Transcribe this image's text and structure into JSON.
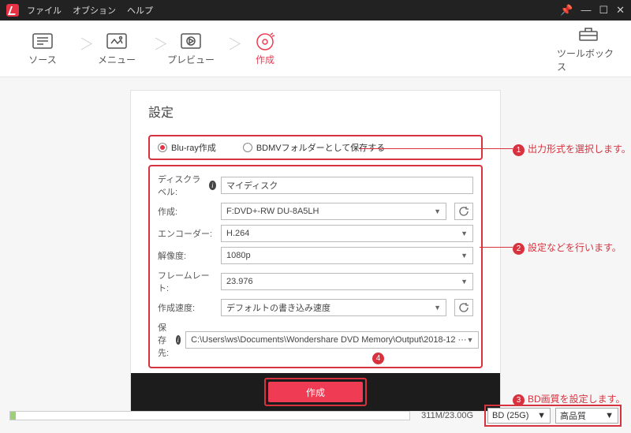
{
  "menu": {
    "file": "ファイル",
    "options": "オブション",
    "help": "ヘルプ"
  },
  "win": {
    "pin": "📌",
    "min": "—",
    "max": "☐",
    "close": "✕"
  },
  "steps": {
    "source": "ソース",
    "menu": "メニュー",
    "preview": "プレビュー",
    "create": "作成",
    "toolbox": "ツールボックス"
  },
  "title": "設定",
  "formats": {
    "bluray": "Blu-ray作成",
    "bdmv": "BDMVフォルダーとして保存する"
  },
  "labels": {
    "disclabel": "ディスクラベル:",
    "create": "作成:",
    "encoder": "エンコーダー:",
    "resolution": "解像度:",
    "framerate": "フレームレート:",
    "speed": "作成速度:",
    "saveto": "保存先:"
  },
  "values": {
    "disclabel": "マイディスク",
    "create": "F:DVD+-RW DU-8A5LH",
    "encoder": "H.264",
    "resolution": "1080p",
    "framerate": "23.976",
    "speed": "デフォルトの書き込み速度",
    "saveto": "C:\\Users\\ws\\Documents\\Wondershare DVD Memory\\Output\\2018-12 ···"
  },
  "createbtn": "作成",
  "annotations": {
    "a1": "出力形式を選択します。",
    "a2": "設定などを行います。",
    "a3": "BD画質を設定します。",
    "a4": "4"
  },
  "bottom": {
    "size": "311M/23.00G",
    "bd": "BD (25G)",
    "quality": "高品質"
  }
}
